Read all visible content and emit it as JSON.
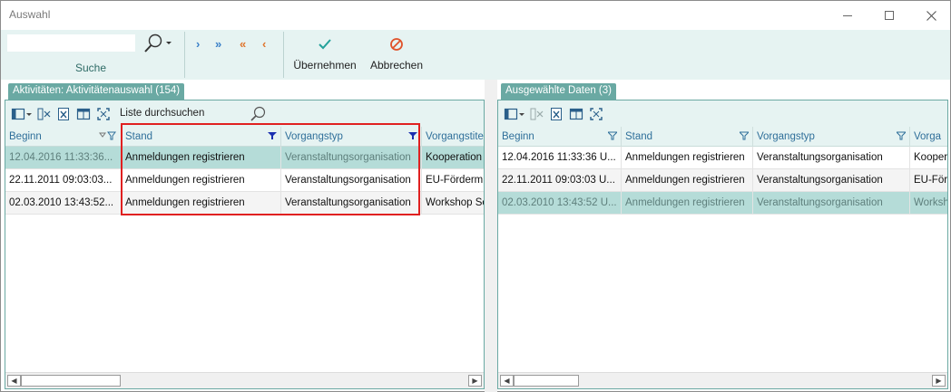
{
  "window": {
    "title": "Auswahl"
  },
  "ribbon": {
    "search_label": "Suche",
    "search_value": "",
    "nav": {
      "add_one": "›",
      "add_all": "»",
      "remove_all": "«",
      "remove_one": "‹"
    },
    "apply_label": "Übernehmen",
    "cancel_label": "Abbrechen"
  },
  "left_panel": {
    "tab_title": "Aktivitäten: Aktivitätenauswahl (154)",
    "list_search_label": "Liste durchsuchen",
    "columns": [
      "Beginn",
      "Stand",
      "Vorgangstyp",
      "Vorgangstitel"
    ],
    "rows": [
      [
        "12.04.2016  11:33:36...",
        "Anmeldungen registrieren",
        "Veranstaltungsorganisation",
        "Kooperation"
      ],
      [
        "22.11.2011  09:03:03...",
        "Anmeldungen registrieren",
        "Veranstaltungsorganisation",
        "EU-Fördermi"
      ],
      [
        "02.03.2010  13:43:52...",
        "Anmeldungen registrieren",
        "Veranstaltungsorganisation",
        "Workshop So"
      ]
    ]
  },
  "right_panel": {
    "tab_title": "Ausgewählte Daten (3)",
    "columns": [
      "Beginn",
      "Stand",
      "Vorgangstyp",
      "Vorga"
    ],
    "rows": [
      [
        "12.04.2016  11:33:36  U...",
        "Anmeldungen registrieren",
        "Veranstaltungsorganisation",
        "Kooper"
      ],
      [
        "22.11.2011  09:03:03  U...",
        "Anmeldungen registrieren",
        "Veranstaltungsorganisation",
        "EU-För"
      ],
      [
        "02.03.2010  13:43:52  U...",
        "Anmeldungen registrieren",
        "Veranstaltungsorganisation",
        "Worksh"
      ]
    ]
  },
  "colors": {
    "accent": "#6aa9a3",
    "ribbon_bg": "#e6f3f2",
    "selection": "#b5dcd8",
    "highlight": "#e02020",
    "filter_active": "#1a2fb0"
  }
}
